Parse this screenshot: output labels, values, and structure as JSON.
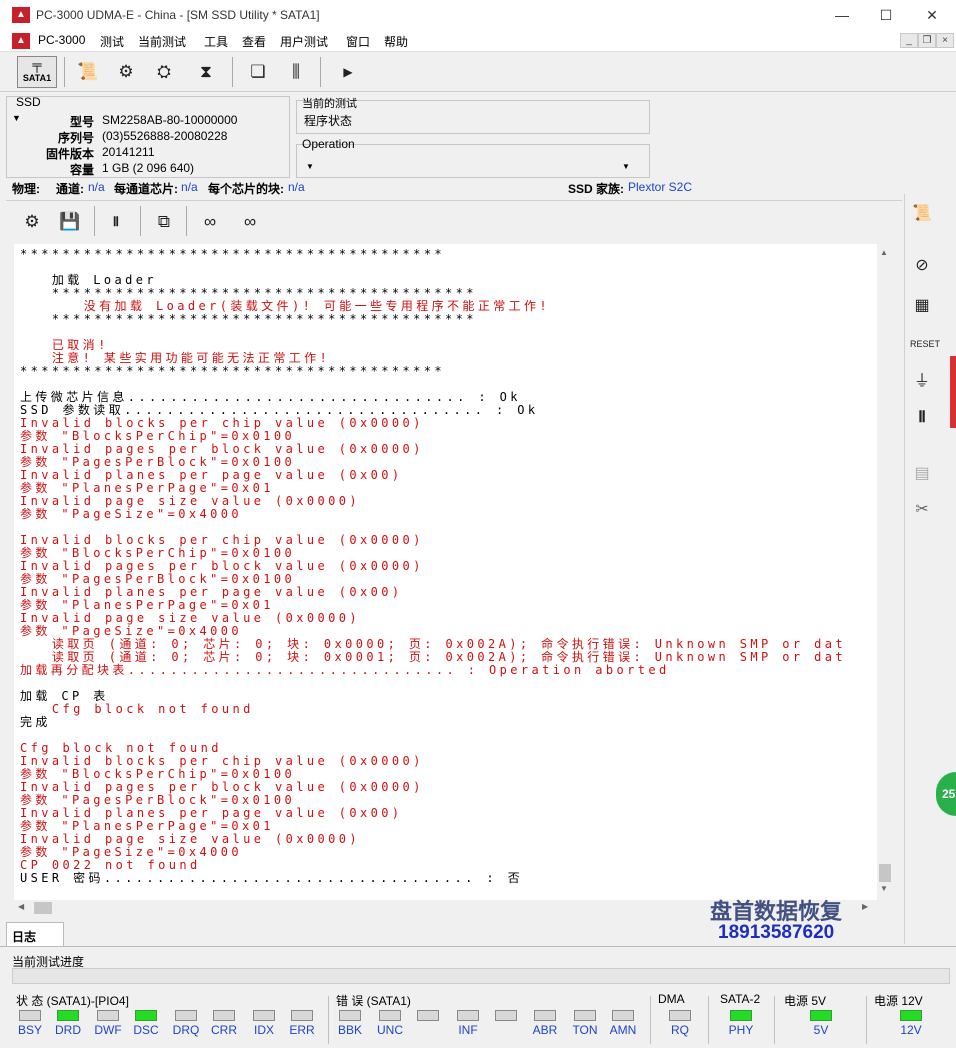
{
  "window": {
    "title": "PC-3000 UDMA-E - China - [SM SSD Utility * SATA1]"
  },
  "menu": {
    "app": "PC-3000",
    "items": [
      "测试",
      "当前测试",
      "工具",
      "查看",
      "用户测试",
      "窗口",
      "帮助"
    ]
  },
  "toolbar": {
    "port_label": "SATA1"
  },
  "ssd": {
    "panel_label": "SSD",
    "model_label": "型号",
    "model": "SM2258AB-80-10000000",
    "serial_label": "序列号",
    "serial": "(03)5526888-20080228",
    "firmware_label": "固件版本",
    "firmware": "20141211",
    "capacity_label": "容量",
    "capacity": "1 GB (2 096 640)"
  },
  "current_test": {
    "label": "当前的测试",
    "value": "程序状态"
  },
  "operation": {
    "label": "Operation"
  },
  "physical": {
    "label": "物理:",
    "channels_label": "通道:",
    "channels": "n/a",
    "chips_label": "每通道芯片:",
    "chips": "n/a",
    "blocks_label": "每个芯片的块:",
    "blocks": "n/a",
    "family_label": "SSD 家族:",
    "family": "Plextor S2C"
  },
  "console_lines": [
    {
      "t": "****************************************",
      "c": "black"
    },
    {
      "t": "",
      "c": "black"
    },
    {
      "t": "   加载 Loader",
      "c": "black"
    },
    {
      "t": "   ****************************************",
      "c": "black"
    },
    {
      "t": "      没有加载 Loader(装载文件)! 可能一些专用程序不能正常工作!",
      "c": "red"
    },
    {
      "t": "   ****************************************",
      "c": "black"
    },
    {
      "t": "",
      "c": "black"
    },
    {
      "t": "   已取消!",
      "c": "red"
    },
    {
      "t": "   注意! 某些实用功能可能无法正常工作!",
      "c": "red"
    },
    {
      "t": "****************************************",
      "c": "black"
    },
    {
      "t": "",
      "c": "black"
    },
    {
      "t": "上传微芯片信息................................ : Ok",
      "c": "black"
    },
    {
      "t": "SSD 参数读取.................................. : Ok",
      "c": "black"
    },
    {
      "t": "Invalid blocks per chip value (0x0000)",
      "c": "red"
    },
    {
      "t": "参数 \"BlocksPerChip\"=0x0100",
      "c": "red"
    },
    {
      "t": "Invalid pages per block value (0x0000)",
      "c": "red"
    },
    {
      "t": "参数 \"PagesPerBlock\"=0x0100",
      "c": "red"
    },
    {
      "t": "Invalid planes per page value (0x00)",
      "c": "red"
    },
    {
      "t": "参数 \"PlanesPerPage\"=0x01",
      "c": "red"
    },
    {
      "t": "Invalid page size value (0x0000)",
      "c": "red"
    },
    {
      "t": "参数 \"PageSize\"=0x4000",
      "c": "red"
    },
    {
      "t": "",
      "c": "black"
    },
    {
      "t": "Invalid blocks per chip value (0x0000)",
      "c": "red"
    },
    {
      "t": "参数 \"BlocksPerChip\"=0x0100",
      "c": "red"
    },
    {
      "t": "Invalid pages per block value (0x0000)",
      "c": "red"
    },
    {
      "t": "参数 \"PagesPerBlock\"=0x0100",
      "c": "red"
    },
    {
      "t": "Invalid planes per page value (0x00)",
      "c": "red"
    },
    {
      "t": "参数 \"PlanesPerPage\"=0x01",
      "c": "red"
    },
    {
      "t": "Invalid page size value (0x0000)",
      "c": "red"
    },
    {
      "t": "参数 \"PageSize\"=0x4000",
      "c": "red"
    },
    {
      "t": "   读取页 (通道: 0; 芯片: 0; 块: 0x0000; 页: 0x002A); 命令执行错误: Unknown SMP or dat",
      "c": "red"
    },
    {
      "t": "   读取页 (通道: 0; 芯片: 0; 块: 0x0001; 页: 0x002A); 命令执行错误: Unknown SMP or dat",
      "c": "red"
    },
    {
      "t": "加载再分配块表............................... : Operation aborted",
      "c": "red"
    },
    {
      "t": "",
      "c": "black"
    },
    {
      "t": "加载 CP 表",
      "c": "black"
    },
    {
      "t": "   Cfg block not found",
      "c": "red"
    },
    {
      "t": "完成",
      "c": "black"
    },
    {
      "t": "",
      "c": "black"
    },
    {
      "t": "Cfg block not found",
      "c": "red"
    },
    {
      "t": "Invalid blocks per chip value (0x0000)",
      "c": "red"
    },
    {
      "t": "参数 \"BlocksPerChip\"=0x0100",
      "c": "red"
    },
    {
      "t": "Invalid pages per block value (0x0000)",
      "c": "red"
    },
    {
      "t": "参数 \"PagesPerBlock\"=0x0100",
      "c": "red"
    },
    {
      "t": "Invalid planes per page value (0x00)",
      "c": "red"
    },
    {
      "t": "参数 \"PlanesPerPage\"=0x01",
      "c": "red"
    },
    {
      "t": "Invalid page size value (0x0000)",
      "c": "red"
    },
    {
      "t": "参数 \"PageSize\"=0x4000",
      "c": "red"
    },
    {
      "t": "CP 0022 not found",
      "c": "red"
    },
    {
      "t": "USER 密码................................... : 否",
      "c": "black"
    }
  ],
  "watermark": {
    "line1": "盘首数据恢复",
    "line2": "18913587620"
  },
  "log_tab": "日志",
  "progress_label": "当前测试进度",
  "status_panel": {
    "status_label": "状 态 (SATA1)-[PIO4]",
    "status_leds": [
      {
        "label": "BSY",
        "on": false
      },
      {
        "label": "DRD",
        "on": true
      },
      {
        "label": "DWF",
        "on": false
      },
      {
        "label": "DSC",
        "on": true
      },
      {
        "label": "DRQ",
        "on": false
      },
      {
        "label": "CRR",
        "on": false
      },
      {
        "label": "IDX",
        "on": false
      },
      {
        "label": "ERR",
        "on": false
      }
    ],
    "error_label": "错 误 (SATA1)",
    "error_leds": [
      {
        "label": "BBK",
        "on": false
      },
      {
        "label": "UNC",
        "on": false
      },
      {
        "label": "",
        "on": false
      },
      {
        "label": "INF",
        "on": false
      },
      {
        "label": "",
        "on": false
      },
      {
        "label": "ABR",
        "on": false
      },
      {
        "label": "TON",
        "on": false
      },
      {
        "label": "AMN",
        "on": false
      }
    ],
    "dma_label": "DMA",
    "dma_led": {
      "label": "RQ",
      "on": false
    },
    "sata_label": "SATA-2",
    "sata_led": {
      "label": "PHY",
      "on": true
    },
    "p5_label": "电源 5V",
    "p5_led": {
      "label": "5V",
      "on": true
    },
    "p12_label": "电源 12V",
    "p12_led": {
      "label": "12V",
      "on": true
    }
  },
  "badge": "25"
}
